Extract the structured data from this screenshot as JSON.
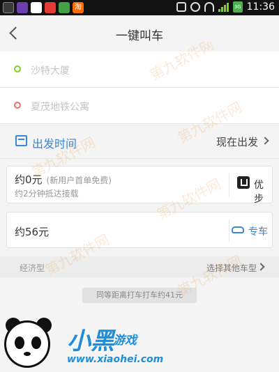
{
  "status_bar": {
    "apps": [
      "shield-app",
      "clock-app",
      "run-app",
      "shop-app",
      "map-app",
      "taobao-app"
    ],
    "taobao_label": "淘",
    "network": "3G",
    "time": "11:36"
  },
  "nav": {
    "title": "一键叫车"
  },
  "addresses": {
    "start": "沙特大厦",
    "end": "夏茂地铁公寓"
  },
  "time_row": {
    "label": "出发时间",
    "value": "现在出发"
  },
  "options": {
    "uber": {
      "price": "约0元",
      "promo": "(新用户首单免费)",
      "eta": "约2分钟抵达接载",
      "name": "优步"
    },
    "premium": {
      "price": "约56元",
      "name": "专车"
    }
  },
  "car_type": {
    "label": "经济型",
    "more": "选择其他车型"
  },
  "comparison": "同等距离打车打车约41元",
  "watermark": {
    "text": "第九软件网"
  },
  "logo": {
    "main": "小黑",
    "sub": "游戏",
    "url": "www.xiaohei.com"
  },
  "colors": {
    "accent": "#3a86d8",
    "start_dot": "#7ed321",
    "end_dot": "#e0736b",
    "status_bar_bg": "#121212"
  }
}
